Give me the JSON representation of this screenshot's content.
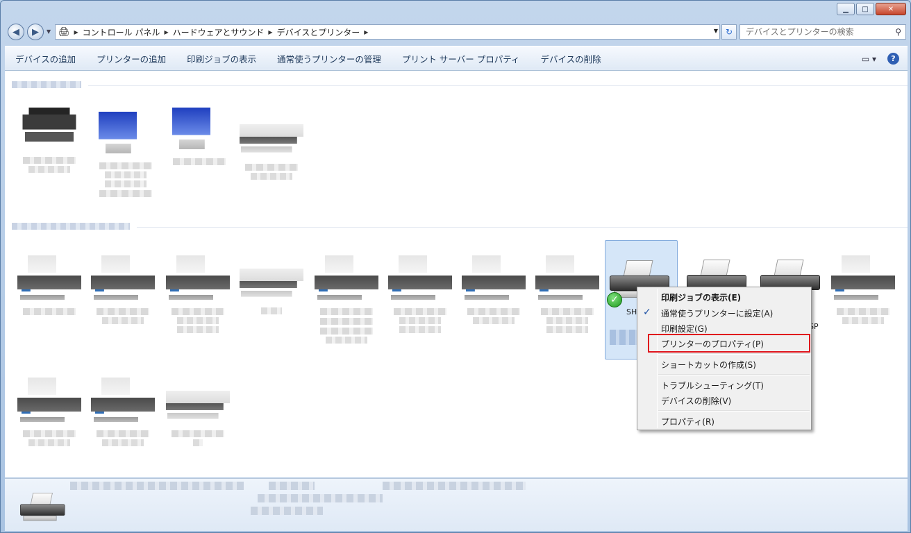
{
  "window": {
    "controls": {
      "minimize": "▁",
      "maximize": "□",
      "close": "✕"
    }
  },
  "navigation": {
    "breadcrumbs": [
      "コントロール パネル",
      "ハードウェアとサウンド",
      "デバイスとプリンター"
    ],
    "search_placeholder": "デバイスとプリンターの検索"
  },
  "toolbar": {
    "items": [
      "デバイスの追加",
      "プリンターの追加",
      "印刷ジョブの表示",
      "通常使うプリンターの管理",
      "プリント サーバー プロパティ",
      "デバイスの削除"
    ]
  },
  "selected_device": {
    "label_fragment": "SH",
    "neighbor_label_fragment": "SP"
  },
  "context_menu": {
    "items": [
      {
        "label": "印刷ジョブの表示(E)",
        "bold": true
      },
      {
        "label": "通常使うプリンターに設定(A)",
        "checked": true
      },
      {
        "label": "印刷設定(G)"
      },
      {
        "label": "プリンターのプロパティ(P)",
        "highlighted": true
      },
      {
        "label": "ショートカットの作成(S)"
      },
      {
        "label": "トラブルシューティング(T)"
      },
      {
        "label": "デバイスの削除(V)"
      },
      {
        "label": "プロパティ(R)"
      }
    ]
  },
  "colors": {
    "highlight_box": "#e0141c",
    "selection_fill": "#d5e6f8",
    "default_check": "#1d9a1d"
  }
}
